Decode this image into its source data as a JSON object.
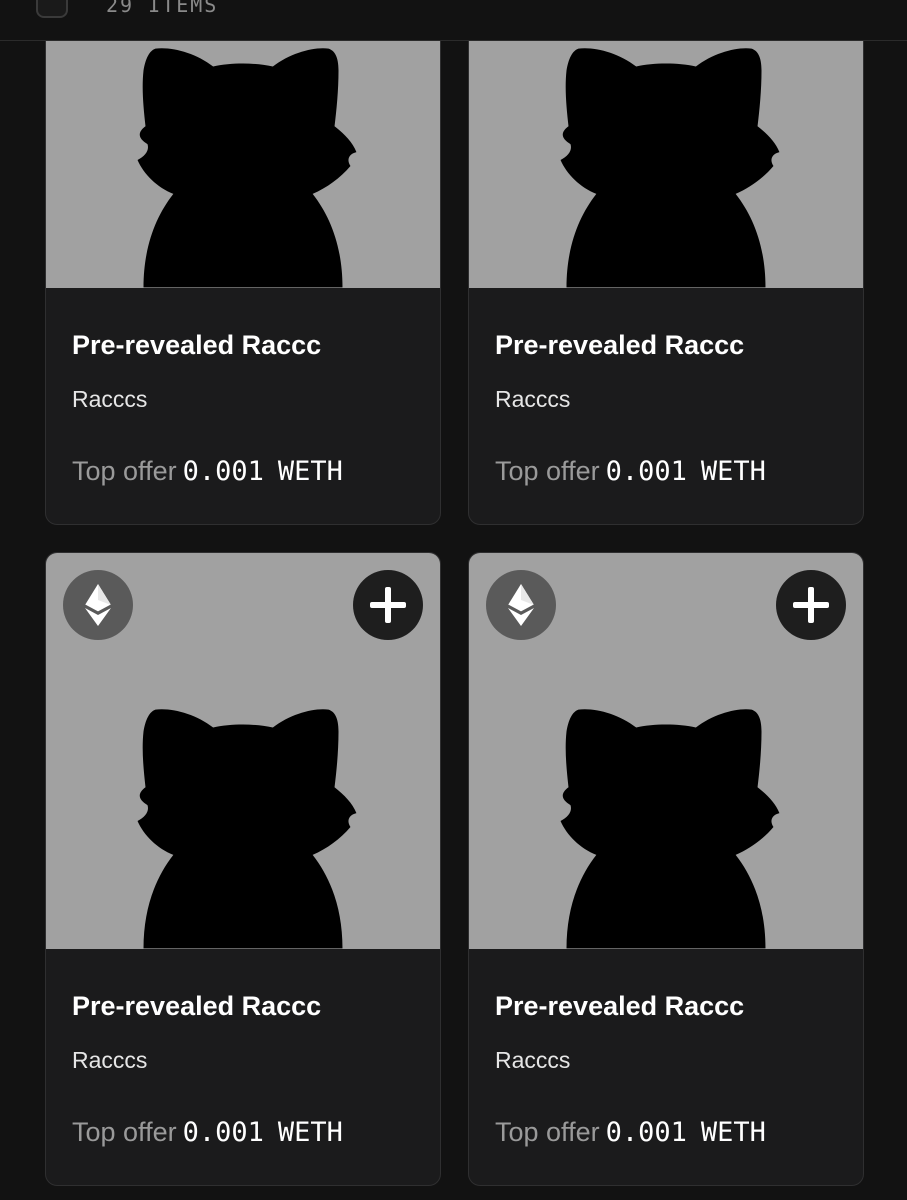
{
  "header": {
    "items_count": "29 ITEMS"
  },
  "icons": {
    "checkbox": "checkbox-icon",
    "ethereum": "ethereum-icon",
    "add": "plus-icon",
    "placeholder": "raccoon-silhouette"
  },
  "colors": {
    "background": "#121212",
    "card": "#1b1b1c",
    "image_bg": "#a1a1a1",
    "silhouette": "#000000",
    "muted_text": "#9a9a9a"
  },
  "cards": [
    {
      "name": "Pre-revealed Raccc",
      "collection": "Racccs",
      "offer_label": "Top offer",
      "offer_amount": "0.001",
      "offer_currency": "WETH"
    },
    {
      "name": "Pre-revealed Raccc",
      "collection": "Racccs",
      "offer_label": "Top offer",
      "offer_amount": "0.001",
      "offer_currency": "WETH"
    },
    {
      "name": "Pre-revealed Raccc",
      "collection": "Racccs",
      "offer_label": "Top offer",
      "offer_amount": "0.001",
      "offer_currency": "WETH"
    },
    {
      "name": "Pre-revealed Raccc",
      "collection": "Racccs",
      "offer_label": "Top offer",
      "offer_amount": "0.001",
      "offer_currency": "WETH"
    }
  ]
}
